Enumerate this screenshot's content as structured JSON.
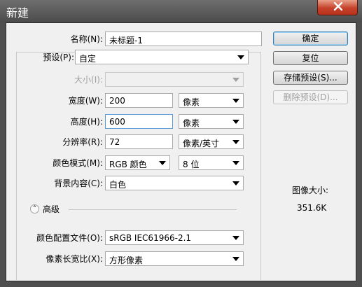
{
  "window": {
    "title": "新建"
  },
  "form": {
    "name_label": "名称(N):",
    "name_value": "未标题-1",
    "preset_label": "预设(P):",
    "preset_value": "自定",
    "size_label": "大小(I):",
    "size_value": "",
    "width_label": "宽度(W):",
    "width_value": "200",
    "width_unit": "像素",
    "height_label": "高度(H):",
    "height_value": "600",
    "height_unit": "像素",
    "resolution_label": "分辨率(R):",
    "resolution_value": "72",
    "resolution_unit": "像素/英寸",
    "color_mode_label": "颜色模式(M):",
    "color_mode_value": "RGB 颜色",
    "bit_depth_value": "8 位",
    "background_label": "背景内容(C):",
    "background_value": "白色",
    "advanced_label": "高级",
    "color_profile_label": "颜色配置文件(O):",
    "color_profile_value": "sRGB IEC61966-2.1",
    "pixel_aspect_label": "像素长宽比(X):",
    "pixel_aspect_value": "方形像素"
  },
  "buttons": {
    "ok": "确定",
    "reset": "复位",
    "save_preset": "存储预设(S)...",
    "delete_preset": "删除预设(D)..."
  },
  "image_size": {
    "label": "图像大小:",
    "value": "351.6K"
  }
}
